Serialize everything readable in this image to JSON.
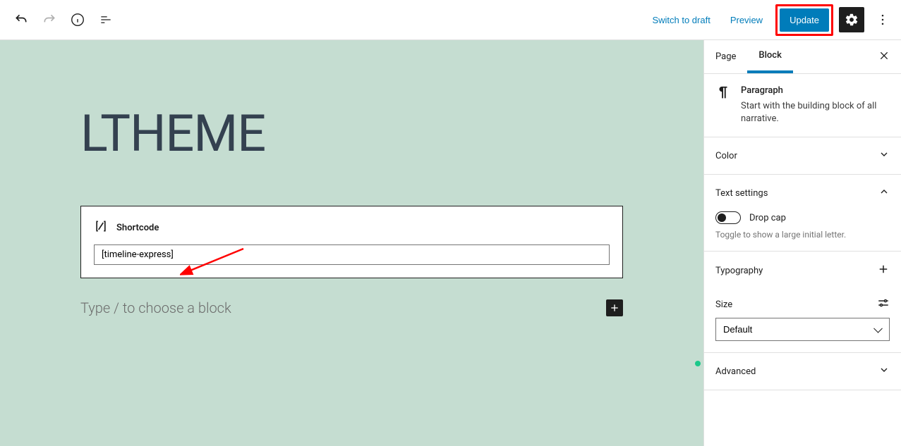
{
  "topbar": {
    "switch_draft": "Switch to draft",
    "preview": "Preview",
    "update": "Update"
  },
  "editor": {
    "page_title": "LTHEME",
    "shortcode_label": "Shortcode",
    "shortcode_value": "[timeline-express]",
    "placeholder": "Type / to choose a block"
  },
  "sidebar": {
    "tabs": {
      "page": "Page",
      "block": "Block"
    },
    "paragraph": {
      "title": "Paragraph",
      "desc": "Start with the building block of all narrative."
    },
    "color": "Color",
    "text_settings": {
      "title": "Text settings",
      "drop_cap": "Drop cap",
      "help": "Toggle to show a large initial letter."
    },
    "typography": "Typography",
    "size": {
      "label": "Size",
      "value": "Default"
    },
    "advanced": "Advanced"
  }
}
